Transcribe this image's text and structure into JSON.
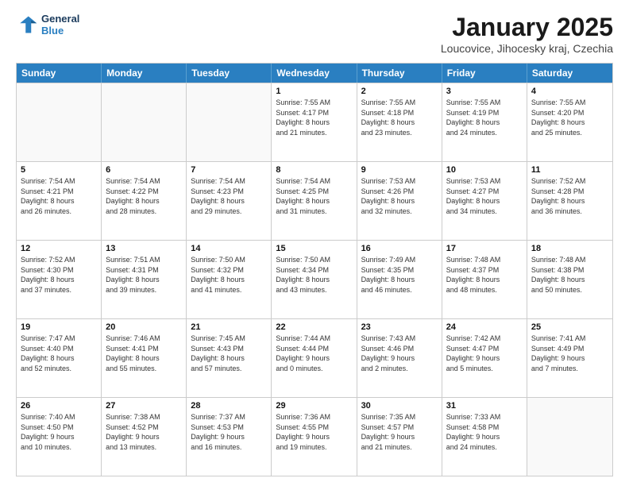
{
  "header": {
    "logo_line1": "General",
    "logo_line2": "Blue",
    "title": "January 2025",
    "subtitle": "Loucovice, Jihocesky kraj, Czechia"
  },
  "days": [
    "Sunday",
    "Monday",
    "Tuesday",
    "Wednesday",
    "Thursday",
    "Friday",
    "Saturday"
  ],
  "weeks": [
    [
      {
        "day": "",
        "info": ""
      },
      {
        "day": "",
        "info": ""
      },
      {
        "day": "",
        "info": ""
      },
      {
        "day": "1",
        "info": "Sunrise: 7:55 AM\nSunset: 4:17 PM\nDaylight: 8 hours\nand 21 minutes."
      },
      {
        "day": "2",
        "info": "Sunrise: 7:55 AM\nSunset: 4:18 PM\nDaylight: 8 hours\nand 23 minutes."
      },
      {
        "day": "3",
        "info": "Sunrise: 7:55 AM\nSunset: 4:19 PM\nDaylight: 8 hours\nand 24 minutes."
      },
      {
        "day": "4",
        "info": "Sunrise: 7:55 AM\nSunset: 4:20 PM\nDaylight: 8 hours\nand 25 minutes."
      }
    ],
    [
      {
        "day": "5",
        "info": "Sunrise: 7:54 AM\nSunset: 4:21 PM\nDaylight: 8 hours\nand 26 minutes."
      },
      {
        "day": "6",
        "info": "Sunrise: 7:54 AM\nSunset: 4:22 PM\nDaylight: 8 hours\nand 28 minutes."
      },
      {
        "day": "7",
        "info": "Sunrise: 7:54 AM\nSunset: 4:23 PM\nDaylight: 8 hours\nand 29 minutes."
      },
      {
        "day": "8",
        "info": "Sunrise: 7:54 AM\nSunset: 4:25 PM\nDaylight: 8 hours\nand 31 minutes."
      },
      {
        "day": "9",
        "info": "Sunrise: 7:53 AM\nSunset: 4:26 PM\nDaylight: 8 hours\nand 32 minutes."
      },
      {
        "day": "10",
        "info": "Sunrise: 7:53 AM\nSunset: 4:27 PM\nDaylight: 8 hours\nand 34 minutes."
      },
      {
        "day": "11",
        "info": "Sunrise: 7:52 AM\nSunset: 4:28 PM\nDaylight: 8 hours\nand 36 minutes."
      }
    ],
    [
      {
        "day": "12",
        "info": "Sunrise: 7:52 AM\nSunset: 4:30 PM\nDaylight: 8 hours\nand 37 minutes."
      },
      {
        "day": "13",
        "info": "Sunrise: 7:51 AM\nSunset: 4:31 PM\nDaylight: 8 hours\nand 39 minutes."
      },
      {
        "day": "14",
        "info": "Sunrise: 7:50 AM\nSunset: 4:32 PM\nDaylight: 8 hours\nand 41 minutes."
      },
      {
        "day": "15",
        "info": "Sunrise: 7:50 AM\nSunset: 4:34 PM\nDaylight: 8 hours\nand 43 minutes."
      },
      {
        "day": "16",
        "info": "Sunrise: 7:49 AM\nSunset: 4:35 PM\nDaylight: 8 hours\nand 46 minutes."
      },
      {
        "day": "17",
        "info": "Sunrise: 7:48 AM\nSunset: 4:37 PM\nDaylight: 8 hours\nand 48 minutes."
      },
      {
        "day": "18",
        "info": "Sunrise: 7:48 AM\nSunset: 4:38 PM\nDaylight: 8 hours\nand 50 minutes."
      }
    ],
    [
      {
        "day": "19",
        "info": "Sunrise: 7:47 AM\nSunset: 4:40 PM\nDaylight: 8 hours\nand 52 minutes."
      },
      {
        "day": "20",
        "info": "Sunrise: 7:46 AM\nSunset: 4:41 PM\nDaylight: 8 hours\nand 55 minutes."
      },
      {
        "day": "21",
        "info": "Sunrise: 7:45 AM\nSunset: 4:43 PM\nDaylight: 8 hours\nand 57 minutes."
      },
      {
        "day": "22",
        "info": "Sunrise: 7:44 AM\nSunset: 4:44 PM\nDaylight: 9 hours\nand 0 minutes."
      },
      {
        "day": "23",
        "info": "Sunrise: 7:43 AM\nSunset: 4:46 PM\nDaylight: 9 hours\nand 2 minutes."
      },
      {
        "day": "24",
        "info": "Sunrise: 7:42 AM\nSunset: 4:47 PM\nDaylight: 9 hours\nand 5 minutes."
      },
      {
        "day": "25",
        "info": "Sunrise: 7:41 AM\nSunset: 4:49 PM\nDaylight: 9 hours\nand 7 minutes."
      }
    ],
    [
      {
        "day": "26",
        "info": "Sunrise: 7:40 AM\nSunset: 4:50 PM\nDaylight: 9 hours\nand 10 minutes."
      },
      {
        "day": "27",
        "info": "Sunrise: 7:38 AM\nSunset: 4:52 PM\nDaylight: 9 hours\nand 13 minutes."
      },
      {
        "day": "28",
        "info": "Sunrise: 7:37 AM\nSunset: 4:53 PM\nDaylight: 9 hours\nand 16 minutes."
      },
      {
        "day": "29",
        "info": "Sunrise: 7:36 AM\nSunset: 4:55 PM\nDaylight: 9 hours\nand 19 minutes."
      },
      {
        "day": "30",
        "info": "Sunrise: 7:35 AM\nSunset: 4:57 PM\nDaylight: 9 hours\nand 21 minutes."
      },
      {
        "day": "31",
        "info": "Sunrise: 7:33 AM\nSunset: 4:58 PM\nDaylight: 9 hours\nand 24 minutes."
      },
      {
        "day": "",
        "info": ""
      }
    ]
  ]
}
